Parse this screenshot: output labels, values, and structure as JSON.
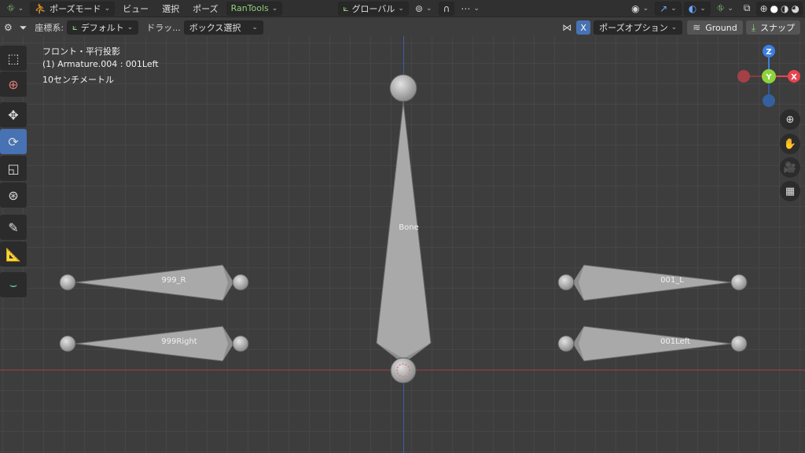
{
  "header": {
    "mode_label": "ポーズモード",
    "menus": [
      "ビュー",
      "選択",
      "ポーズ"
    ],
    "addon_label": "RanTools",
    "transform_orientation": "グローバル"
  },
  "toolbar2": {
    "orientation_label": "座標系:",
    "orientation_value": "デフォルト",
    "drag_label": "ドラッ...",
    "select_mode": "ボックス選択",
    "x_mirror": "X",
    "pose_options": "ポーズオプション",
    "ground_label": "Ground",
    "snap_label": "スナップ"
  },
  "overlay": {
    "view_name": "フロント・平行投影",
    "object_info": "(1) Armature.004 : 001Left",
    "scale": "10センチメートル"
  },
  "gizmo": {
    "z": "Z",
    "x": "X",
    "y": "Y"
  },
  "bones": {
    "center": "Bone",
    "right_top": "999_R",
    "right_bottom": "999Right",
    "left_top": "001_L",
    "left_bottom": "001Left"
  },
  "colors": {
    "accent_blue": "#4772b3",
    "axis_x": "#e8444f",
    "axis_y": "#8cd43a",
    "axis_z": "#3d7ee0",
    "bone": "#a8a8a8"
  }
}
